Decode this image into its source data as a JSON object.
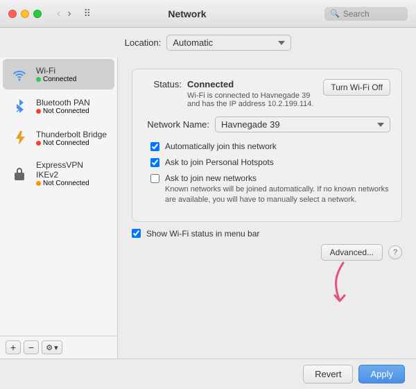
{
  "titleBar": {
    "title": "Network",
    "searchPlaceholder": "Search"
  },
  "locationBar": {
    "label": "Location:",
    "value": "Automatic"
  },
  "sidebar": {
    "items": [
      {
        "id": "wifi",
        "name": "Wi-Fi",
        "status": "Connected",
        "statusColor": "green",
        "icon": "wifi"
      },
      {
        "id": "bluetooth-pan",
        "name": "Bluetooth PAN",
        "status": "Not Connected",
        "statusColor": "red",
        "icon": "bluetooth"
      },
      {
        "id": "thunderbolt-bridge",
        "name": "Thunderbolt Bridge",
        "status": "Not Connected",
        "statusColor": "red",
        "icon": "thunderbolt"
      },
      {
        "id": "expressvpn",
        "name": "ExpressVPN IKEv2",
        "status": "Not Connected",
        "statusColor": "yellow",
        "icon": "lock"
      }
    ],
    "footer": {
      "addLabel": "+",
      "removeLabel": "−",
      "gearLabel": "⚙",
      "chevronLabel": "›"
    }
  },
  "mainPanel": {
    "statusLabel": "Status:",
    "statusValue": "Connected",
    "turnWifiLabel": "Turn Wi-Fi Off",
    "statusDesc": "Wi-Fi is connected to Havnegade 39 and has the IP address 10.2.199.114.",
    "networkNameLabel": "Network Name:",
    "networkNameValue": "Havnegade 39",
    "checkboxes": [
      {
        "id": "auto-join",
        "label": "Automatically join this network",
        "checked": true,
        "note": ""
      },
      {
        "id": "personal-hotspots",
        "label": "Ask to join Personal Hotspots",
        "checked": true,
        "note": ""
      },
      {
        "id": "new-networks",
        "label": "Ask to join new networks",
        "checked": false,
        "note": "Known networks will be joined automatically. If no known networks are available, you will have to manually select a network."
      }
    ],
    "showWifiLabel": "Show Wi-Fi status in menu bar",
    "showWifiChecked": true,
    "advancedLabel": "Advanced...",
    "helpLabel": "?"
  },
  "bottomButtons": {
    "revertLabel": "Revert",
    "applyLabel": "Apply"
  }
}
